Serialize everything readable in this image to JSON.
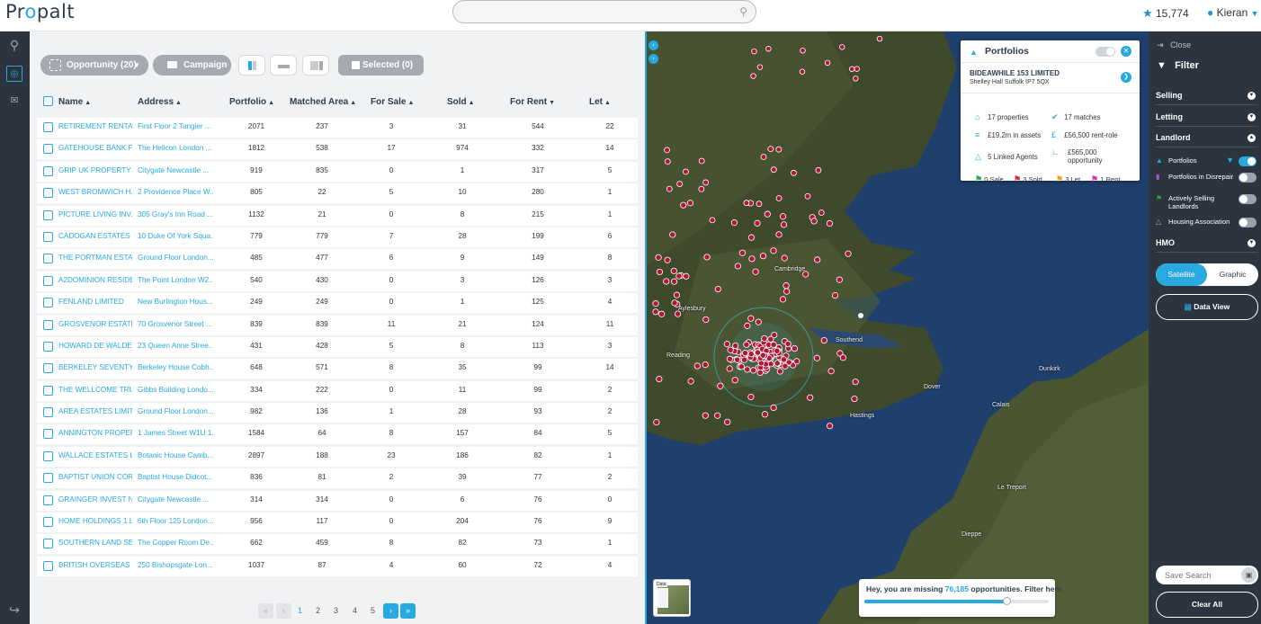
{
  "header": {
    "logo_prefix": "Pr",
    "logo_o": "o",
    "logo_suffix": "palt",
    "search_placeholder": "",
    "credits": "15,774",
    "user_name": "Kieran"
  },
  "toolbar": {
    "opportunity_label": "Opportunity (20)",
    "campaign_label": "Campaign",
    "selected_label": "Selected (0)"
  },
  "columns": [
    {
      "label": "Name",
      "arrow": "▲"
    },
    {
      "label": "Address",
      "arrow": "▲"
    },
    {
      "label": "Portfolio",
      "arrow": "▲"
    },
    {
      "label": "Matched Area",
      "arrow": "▲"
    },
    {
      "label": "For Sale",
      "arrow": "▲"
    },
    {
      "label": "Sold",
      "arrow": "▲"
    },
    {
      "label": "For Rent",
      "arrow": "▼"
    },
    {
      "label": "Let",
      "arrow": "▲"
    }
  ],
  "rows": [
    [
      "RETIREMENT RENTA...",
      "First Floor 2 Tangier ...",
      "2071",
      "237",
      "3",
      "31",
      "544",
      "22"
    ],
    [
      "GATEHOUSE BANK P...",
      "The Helicon London ...",
      "1812",
      "538",
      "17",
      "974",
      "332",
      "14"
    ],
    [
      "GRIP UK PROPERTY I...",
      "Citygate Newcastle ...",
      "919",
      "835",
      "0",
      "1",
      "317",
      "5"
    ],
    [
      "WEST BROMWICH H...",
      "2 Providence Place W...",
      "805",
      "22",
      "5",
      "10",
      "280",
      "1"
    ],
    [
      "PICTURE LIVING INV...",
      "305 Gray's Inn Road ...",
      "1132",
      "21",
      "0",
      "8",
      "215",
      "1"
    ],
    [
      "CADOGAN ESTATES ...",
      "10 Duke Of York Squa...",
      "779",
      "779",
      "7",
      "28",
      "199",
      "6"
    ],
    [
      "THE PORTMAN ESTA...",
      "Ground Floor London...",
      "485",
      "477",
      "6",
      "9",
      "149",
      "8"
    ],
    [
      "A2DOMINION RESIDE...",
      "The Point London W2...",
      "540",
      "430",
      "0",
      "3",
      "126",
      "3"
    ],
    [
      "FENLAND LIMITED",
      "New Burlington Hous...",
      "249",
      "249",
      "0",
      "1",
      "125",
      "4"
    ],
    [
      "GROSVENOR ESTATE...",
      "70 Grosvenor Street ...",
      "839",
      "839",
      "11",
      "21",
      "124",
      "11"
    ],
    [
      "HOWARD DE WALDE...",
      "23 Queen Anne Stree...",
      "431",
      "428",
      "5",
      "8",
      "113",
      "3"
    ],
    [
      "BERKELEY SEVENTY-...",
      "Berkeley House Cobh...",
      "648",
      "571",
      "8",
      "35",
      "99",
      "14"
    ],
    [
      "THE WELLCOME TRU...",
      "Gibbs Building Londo...",
      "334",
      "222",
      "0",
      "11",
      "99",
      "2"
    ],
    [
      "AREA ESTATES LIMIT...",
      "Ground Floor London...",
      "982",
      "136",
      "1",
      "28",
      "93",
      "2"
    ],
    [
      "ANNINGTON PROPER...",
      "1 James Street W1U 1...",
      "1584",
      "64",
      "8",
      "157",
      "84",
      "5"
    ],
    [
      "WALLACE ESTATES L...",
      "Botanic House Camb...",
      "2897",
      "188",
      "23",
      "186",
      "82",
      "1"
    ],
    [
      "BAPTIST UNION COR...",
      "Baptist House Didcot...",
      "836",
      "81",
      "2",
      "39",
      "77",
      "2"
    ],
    [
      "GRAINGER INVEST N...",
      "Citygate Newcastle ...",
      "314",
      "314",
      "0",
      "6",
      "76",
      "0"
    ],
    [
      "HOME HOLDINGS 1 LI...",
      "6th Floor 125 London...",
      "956",
      "117",
      "0",
      "204",
      "76",
      "9"
    ],
    [
      "SOUTHERN LAND SE...",
      "The Copper Room De...",
      "662",
      "459",
      "8",
      "82",
      "73",
      "1"
    ],
    [
      "BRITISH OVERSEAS B...",
      "250 Bishopsgate Lon...",
      "1037",
      "87",
      "4",
      "60",
      "72",
      "4"
    ]
  ],
  "pagination": {
    "first": "«",
    "prev": "‹",
    "pages": [
      "1",
      "2",
      "3",
      "4",
      "5"
    ],
    "current": "1",
    "next": "›",
    "last": "»"
  },
  "map": {
    "places": [
      "Cambridge",
      "Aylesbury",
      "Reading",
      "Southend",
      "Dover",
      "Dunkirk",
      "Calais",
      "Dieppe",
      "Le Treport",
      "Hastings"
    ],
    "popup": {
      "title": "Portfolios",
      "company": "BIDEAWHILE 153 LIMITED",
      "address": "Shelley Hall Suffolk IP7 5QX",
      "properties": "17 properties",
      "matches": "17 matches",
      "assets": "£19.2m in assets",
      "rent_role": "£56,500 rent-role",
      "agents": "5 Linked Agents",
      "opportunity_value": "£565,000",
      "opportunity_label": "opportunity",
      "flags": [
        {
          "label": "0 Sale",
          "color": "#2aa845"
        },
        {
          "label": "3 Sold",
          "color": "#d9263a"
        },
        {
          "label": "3 Let",
          "color": "#f2a31b"
        },
        {
          "label": "1 Rent",
          "color": "#d92bb0"
        }
      ]
    },
    "mini_label": "Data",
    "missing_prefix": "Hey, you are missing ",
    "missing_count": "76,185",
    "missing_suffix": " opportunities. Filter here.",
    "missing_progress": 0.77
  },
  "filter": {
    "close_label": "Close",
    "title": "Filter",
    "sections": {
      "selling": "Selling",
      "letting": "Letting",
      "landlord": "Landlord",
      "hmo": "HMO"
    },
    "items": [
      {
        "label": "Portfolios",
        "on": true
      },
      {
        "label": "Portfolios in Disrepair",
        "on": false
      },
      {
        "label": "Actively Selling Landlords",
        "on": false
      },
      {
        "label": "Housing Association",
        "on": false
      }
    ],
    "satellite": "Satellite",
    "graphic": "Graphic",
    "data_view": "Data View",
    "save_placeholder": "Save Search",
    "clear_all": "Clear All"
  }
}
